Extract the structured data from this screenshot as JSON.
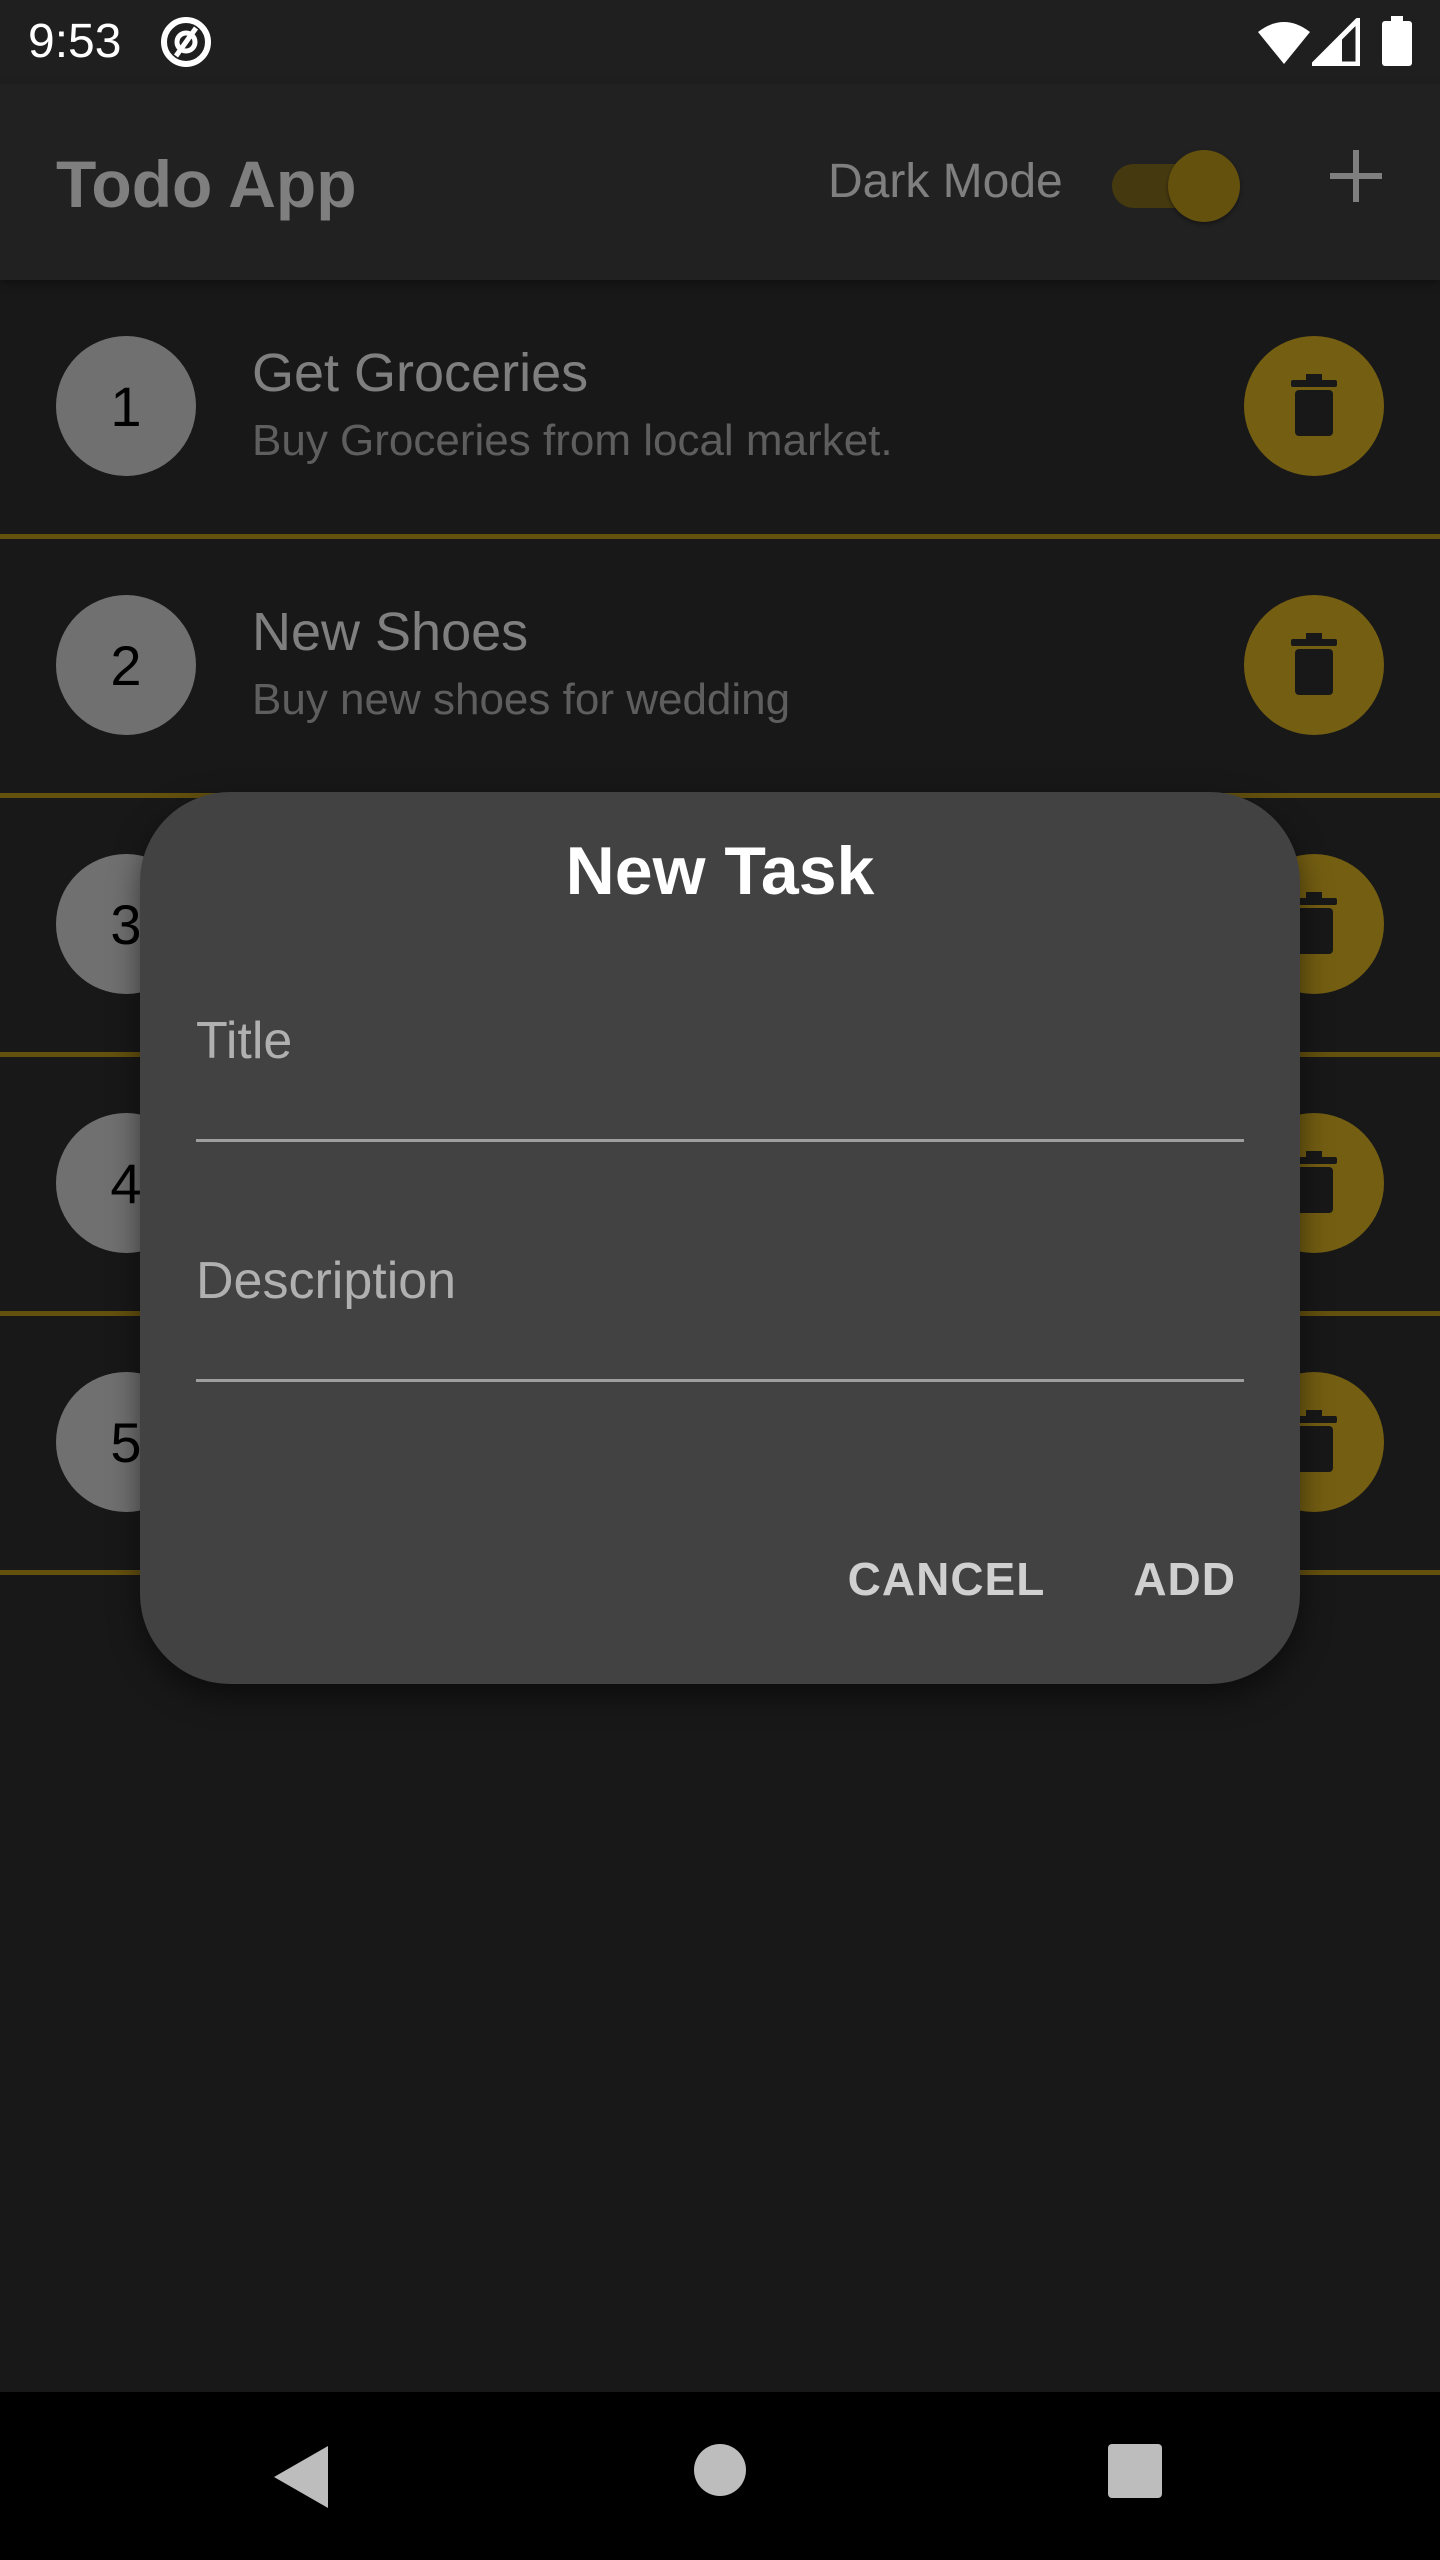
{
  "status_bar": {
    "time": "9:53"
  },
  "app_bar": {
    "title": "Todo App",
    "dark_mode_label": "Dark Mode",
    "dark_mode_enabled": true
  },
  "tasks": [
    {
      "number": "1",
      "title": "Get Groceries",
      "description": "Buy Groceries from local market."
    },
    {
      "number": "2",
      "title": "New Shoes",
      "description": "Buy new shoes for wedding"
    },
    {
      "number": "3",
      "title": "",
      "description": ""
    },
    {
      "number": "4",
      "title": "",
      "description": ""
    },
    {
      "number": "5",
      "title": "",
      "description": ""
    }
  ],
  "dialog": {
    "title": "New Task",
    "title_field": {
      "placeholder": "Title",
      "value": ""
    },
    "description_field": {
      "placeholder": "Description",
      "value": ""
    },
    "cancel_label": "CANCEL",
    "add_label": "ADD"
  },
  "colors": {
    "accent": "#e8bc24",
    "background": "#303030",
    "surface": "#424242"
  },
  "icons": {
    "app_bar_add": "plus-icon",
    "task_delete": "trash-icon",
    "nav_back": "back-triangle-icon",
    "nav_home": "home-circle-icon",
    "nav_recents": "recents-square-icon"
  }
}
